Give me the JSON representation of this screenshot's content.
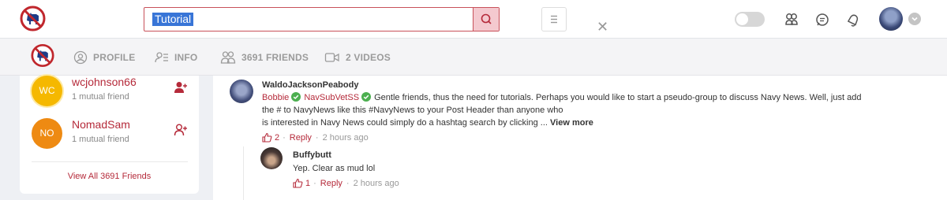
{
  "search": {
    "value": "Tutorial"
  },
  "nav": {
    "profile": "PROFILE",
    "info": "INFO",
    "friends": "3691 FRIENDS",
    "videos": "2 VIDEOS"
  },
  "friends_card": {
    "items": [
      {
        "initials": "WC",
        "name": "wcjohnson66",
        "mutual": "1 mutual friend",
        "color": "#f5b800"
      },
      {
        "initials": "NO",
        "name": "NomadSam",
        "mutual": "1 mutual friend",
        "color": "#ee8a12"
      }
    ],
    "view_all": "View All 3691 Friends"
  },
  "comments": [
    {
      "author": "WaldoJacksonPeabody",
      "tag1": "Bobbie",
      "tag2": "NavSubVetSS",
      "line1": "Gentle friends, thus the need for tutorials. Perhaps you would like to start a pseudo-group to discuss Navy News. Well, just add",
      "line2": "the # to NavyNews like this #NavyNews to your Post Header than anyone who",
      "line3": "is interested in Navy News could simply do a hashtag search by clicking ...",
      "view_more": "View more",
      "likes": "2",
      "reply": "Reply",
      "time": "2 hours ago"
    },
    {
      "author": "Buffybutt",
      "text": "Yep. Clear as mud lol",
      "likes": "1",
      "reply": "Reply",
      "time": "2 hours ago"
    }
  ],
  "colors": {
    "accent": "#b52a3a",
    "search_border": "#c8515a",
    "verified": "#4caf50"
  }
}
